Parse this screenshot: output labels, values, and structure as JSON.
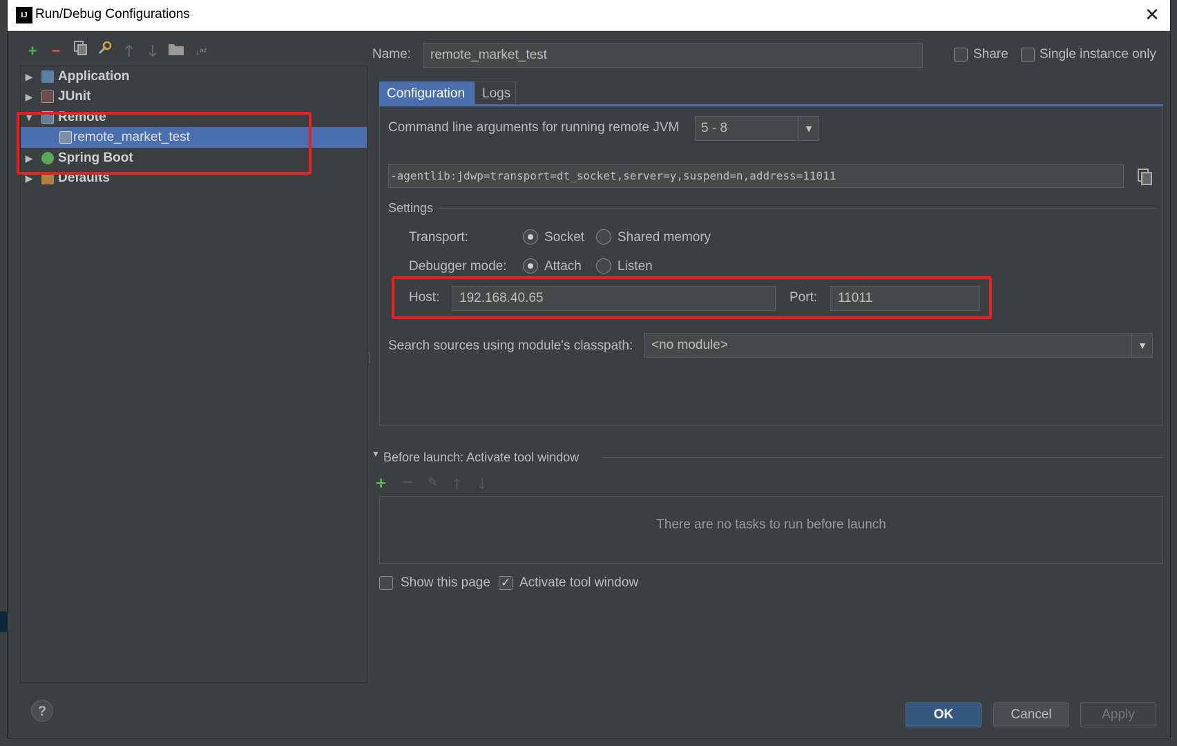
{
  "window": {
    "title": "Run/Debug Configurations",
    "logo_text": "IJ"
  },
  "toolbar": {
    "add": "+",
    "remove": "−"
  },
  "tree": {
    "items": [
      {
        "label": "Application",
        "expanded": false
      },
      {
        "label": "JUnit",
        "expanded": false
      },
      {
        "label": "Remote",
        "expanded": true
      },
      {
        "label": "remote_market_test",
        "selected": true
      },
      {
        "label": "Spring Boot",
        "expanded": false
      },
      {
        "label": "Defaults",
        "expanded": false
      }
    ]
  },
  "name_field": {
    "label": "Name:",
    "value": "remote_market_test"
  },
  "share": {
    "label": "Share",
    "checked": false
  },
  "single_instance": {
    "label": "Single instance only",
    "checked": false
  },
  "tabs": [
    {
      "label": "Configuration",
      "active": true
    },
    {
      "label": "Logs",
      "active": false
    }
  ],
  "cmdline": {
    "label": "Command line arguments for running remote JVM",
    "jdk_select": "5 - 8",
    "value": "-agentlib:jdwp=transport=dt_socket,server=y,suspend=n,address=11011"
  },
  "settings": {
    "title": "Settings",
    "transport_label": "Transport:",
    "transport_options": [
      "Socket",
      "Shared memory"
    ],
    "transport_selected": "Socket",
    "debugger_label": "Debugger mode:",
    "debugger_options": [
      "Attach",
      "Listen"
    ],
    "debugger_selected": "Attach",
    "host_label": "Host:",
    "host_value": "192.168.40.65",
    "port_label": "Port:",
    "port_value": "11011"
  },
  "module": {
    "label": "Search sources using module's classpath:",
    "value": "<no module>"
  },
  "before_launch": {
    "title": "Before launch: Activate tool window",
    "empty_text": "There are no tasks to run before launch"
  },
  "show_page": {
    "label": "Show this page",
    "checked": false
  },
  "activate_tool": {
    "label": "Activate tool window",
    "checked": true
  },
  "buttons": {
    "ok": "OK",
    "cancel": "Cancel",
    "apply": "Apply"
  },
  "help": "?",
  "colors": {
    "accent": "#4b6eaf",
    "highlight": "#e32121",
    "ok": "#365880"
  }
}
